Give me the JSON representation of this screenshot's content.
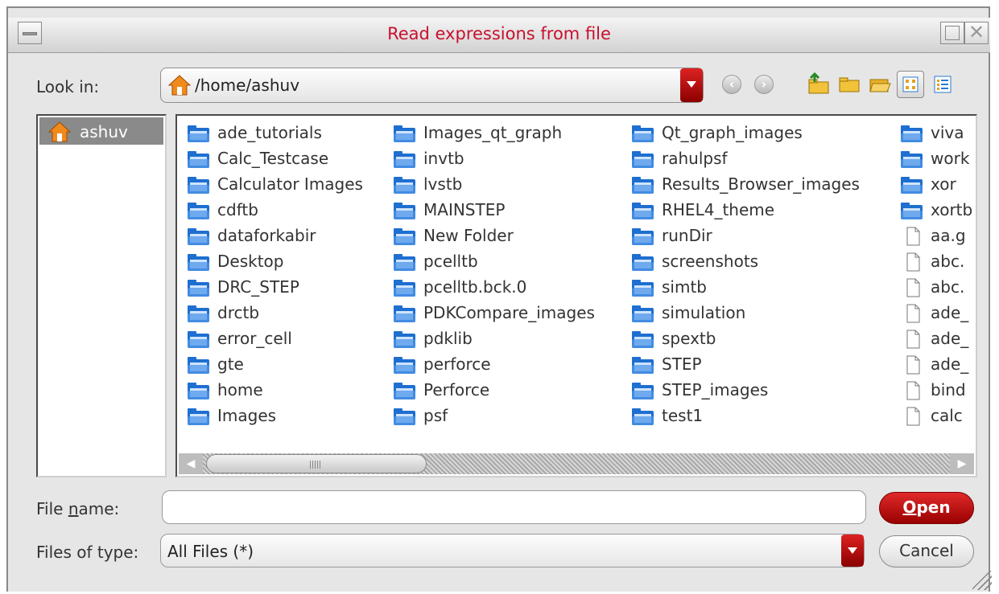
{
  "window": {
    "title": "Read expressions from file"
  },
  "look_in": {
    "label": "Look in:",
    "path": "/home/ashuv"
  },
  "sidebar": {
    "items": [
      {
        "label": "ashuv",
        "icon": "home-icon"
      }
    ]
  },
  "files": {
    "columns": [
      [
        "ade_tutorials",
        "Calc_Testcase",
        "Calculator Images",
        "cdftb",
        "dataforkabir",
        "Desktop",
        "DRC_STEP",
        "drctb",
        "error_cell",
        "gte",
        "home",
        "Images"
      ],
      [
        "Images_qt_graph",
        "invtb",
        "lvstb",
        "MAINSTEP",
        "New Folder",
        "pcelltb",
        "pcelltb.bck.0",
        "PDKCompare_images",
        "pdklib",
        "perforce",
        "Perforce",
        "psf"
      ],
      [
        "Qt_graph_images",
        "rahulpsf",
        "Results_Browser_images",
        "RHEL4_theme",
        "runDir",
        "screenshots",
        "simtb",
        "simulation",
        "spextb",
        "STEP",
        "STEP_images",
        "test1"
      ],
      [
        "viva",
        "work",
        "xor",
        "xortb",
        "aa.g",
        "abc.",
        "abc.",
        "ade_",
        "ade_",
        "ade_",
        "bind",
        "calc"
      ]
    ],
    "column4_types": [
      "folder",
      "folder",
      "folder",
      "folder",
      "file",
      "file",
      "file",
      "file",
      "file",
      "file",
      "file",
      "file"
    ]
  },
  "file_name": {
    "label_before": "File ",
    "label_mnemonic": "n",
    "label_after": "ame:",
    "value": ""
  },
  "file_type": {
    "label": "Files of type:",
    "value": "All Files (*)"
  },
  "buttons": {
    "open_mnemonic": "O",
    "open_rest": "pen",
    "cancel": "Cancel"
  },
  "colors": {
    "accent": "#c8102e",
    "folder": "#1e6fd0",
    "selection": "#8a8a8a"
  }
}
